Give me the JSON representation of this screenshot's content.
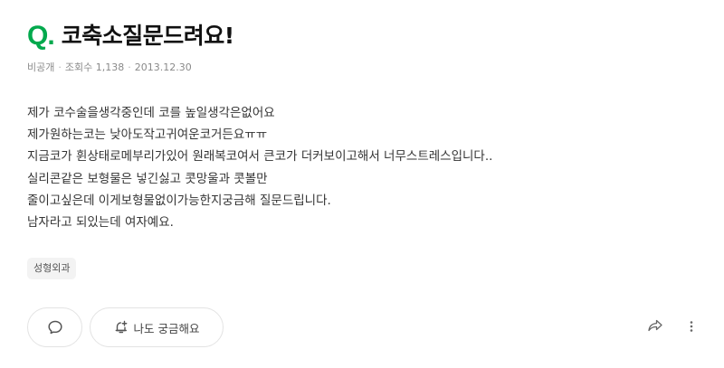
{
  "question": {
    "q_label": "Q",
    "q_dot": ".",
    "title": "코축소질문드려요!"
  },
  "meta": {
    "visibility": "비공개",
    "views": "조회수 1,138",
    "date": "2013.12.30",
    "separator": "·"
  },
  "body_lines": [
    "제가 코수술을생각중인데 코를 높일생각은없어요",
    "제가원하는코는 낮아도작고귀여운코거든요ㅠㅠ",
    "지금코가 휜상태로메부리가있어 원래복코여서 큰코가 더커보이고해서 너무스트레스입니다..",
    "실리콘같은 보형물은 넣긴싫고 콧망울과 콧볼만",
    "줄이고싶은데 이게보형물없이가능한지궁금해 질문드립니다.",
    "남자라고 되있는데 여자예요."
  ],
  "tag": "성형외과",
  "actions": {
    "curious_label": "나도 궁금해요"
  },
  "colors": {
    "brand": "#03a94d",
    "icon": "#555555"
  }
}
